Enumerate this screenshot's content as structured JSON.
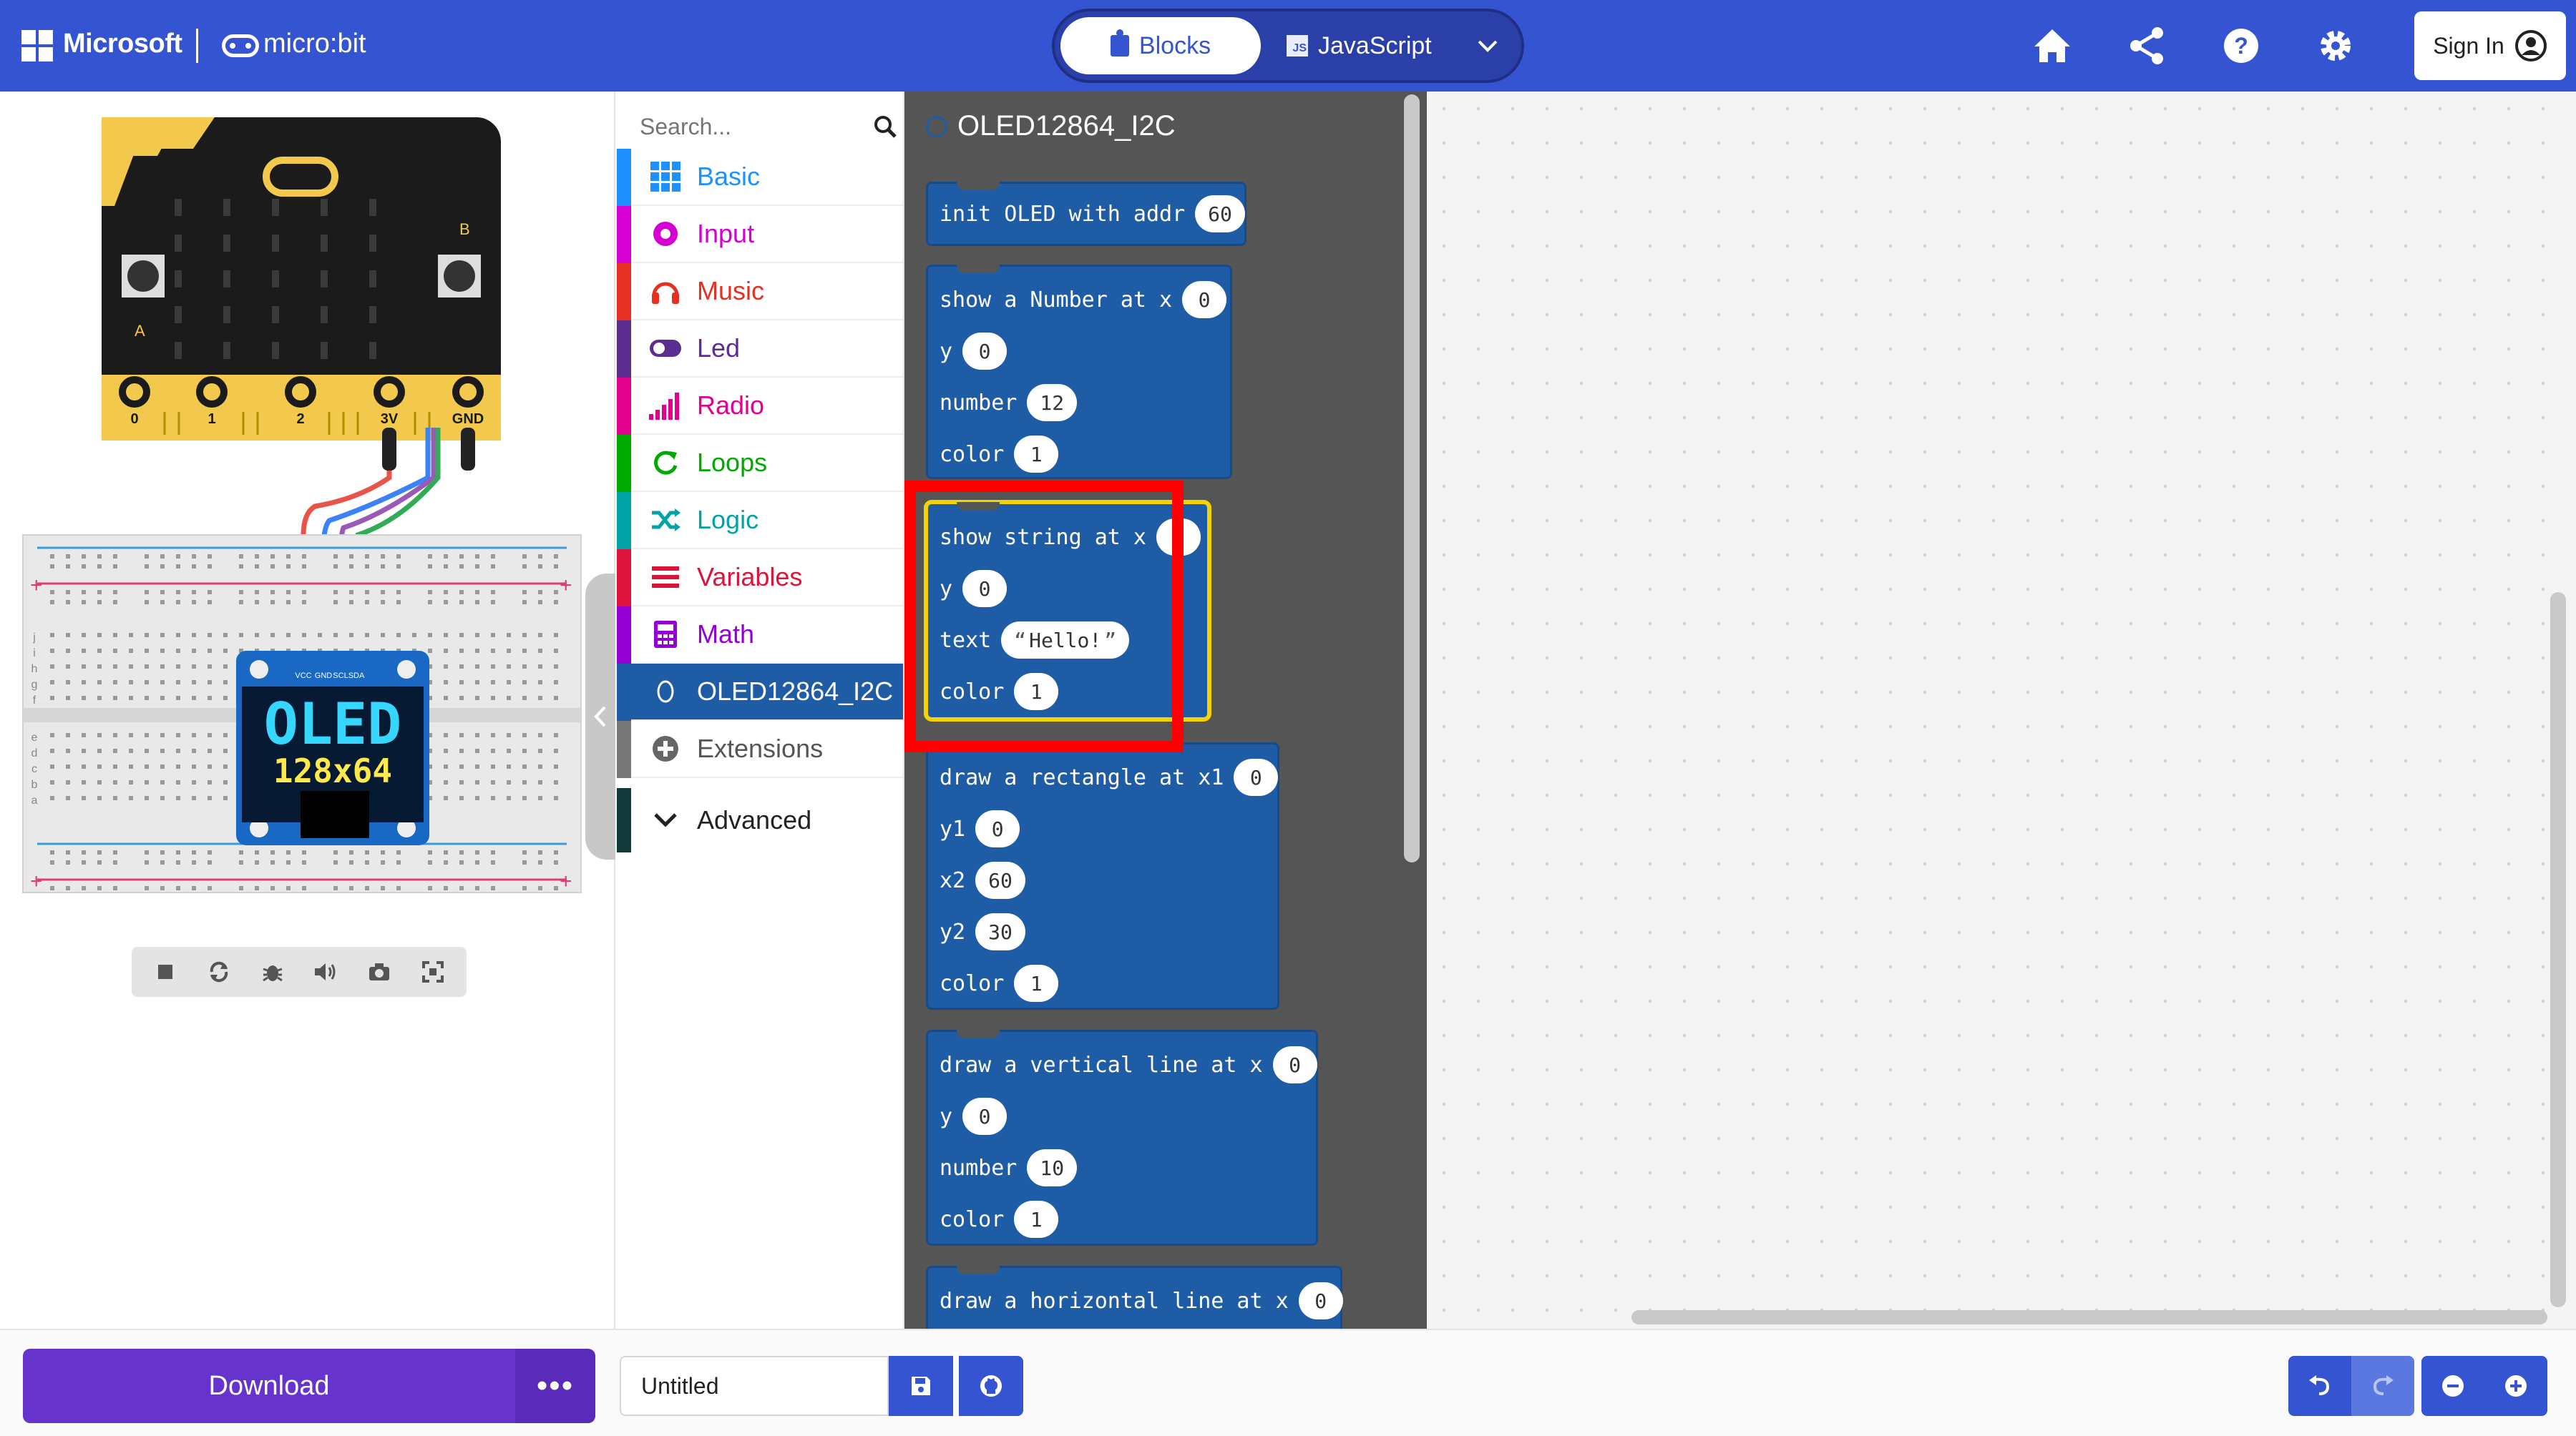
{
  "header": {
    "microsoft_label": "Microsoft",
    "microbit_label": "micro:bit",
    "tabs": {
      "blocks": "Blocks",
      "javascript": "JavaScript",
      "js_badge": "JS"
    },
    "sign_in": "Sign In",
    "icons": [
      "home-icon",
      "share-icon",
      "help-icon",
      "settings-icon"
    ],
    "brand_color": "#3454d1"
  },
  "simulator": {
    "pin_labels": [
      "0",
      "1",
      "2",
      "3V",
      "GND"
    ],
    "button_labels": [
      "A",
      "B"
    ],
    "oled_title": "OLED",
    "oled_size": "128x64",
    "oled_pins": [
      "VCC",
      "GND",
      "SCL",
      "SDA"
    ],
    "row_letters_top": [
      "j",
      "i",
      "h",
      "g",
      "f"
    ],
    "row_letters_bottom": [
      "e",
      "d",
      "c",
      "b",
      "a"
    ],
    "controls": [
      "stop-icon",
      "restart-icon",
      "debug-icon",
      "mute-icon",
      "screenshot-icon",
      "fullscreen-icon"
    ]
  },
  "toolbox": {
    "search_placeholder": "Search...",
    "categories": [
      {
        "label": "Basic",
        "color": "#1e90ff"
      },
      {
        "label": "Input",
        "color": "#d400d4"
      },
      {
        "label": "Music",
        "color": "#e63022"
      },
      {
        "label": "Led",
        "color": "#5c2d91"
      },
      {
        "label": "Radio",
        "color": "#e3008c"
      },
      {
        "label": "Loops",
        "color": "#00aa00"
      },
      {
        "label": "Logic",
        "color": "#00a4a6"
      },
      {
        "label": "Variables",
        "color": "#dc143c"
      },
      {
        "label": "Math",
        "color": "#9400d3"
      },
      {
        "label": "OLED12864_I2C",
        "color": "#1f5ca6"
      },
      {
        "label": "Extensions",
        "color": "#777777"
      },
      {
        "label": "Advanced",
        "color": "#123a3a"
      }
    ]
  },
  "flyout": {
    "title": "OLED12864_I2C",
    "blocks": {
      "init": {
        "label": "init OLED with addr",
        "addr": "60"
      },
      "number": {
        "label": "show a Number at x",
        "x": "0",
        "y_label": "y",
        "y": "0",
        "n_label": "number",
        "n": "12",
        "c_label": "color",
        "c": "1"
      },
      "string": {
        "label": "show string at x",
        "x": "0",
        "y_label": "y",
        "y": "0",
        "t_label": "text",
        "t": "Hello!",
        "c_label": "color",
        "c": "1"
      },
      "rect": {
        "label": "draw a rectangle at x1",
        "x1": "0",
        "y1_label": "y1",
        "y1": "0",
        "x2_label": "x2",
        "x2": "60",
        "y2_label": "y2",
        "y2": "30",
        "c_label": "color",
        "c": "1"
      },
      "vline": {
        "label": "draw a vertical line at x",
        "x": "0",
        "y_label": "y",
        "y": "0",
        "n_label": "number",
        "n": "10",
        "c_label": "color",
        "c": "1"
      },
      "hline": {
        "label": "draw a horizontal line at x",
        "x": "0"
      }
    },
    "block_color": "#1f5ca6",
    "highlight_color": "#ff0000"
  },
  "bottom": {
    "download": "Download",
    "more": "•••",
    "project_name": "Untitled"
  }
}
